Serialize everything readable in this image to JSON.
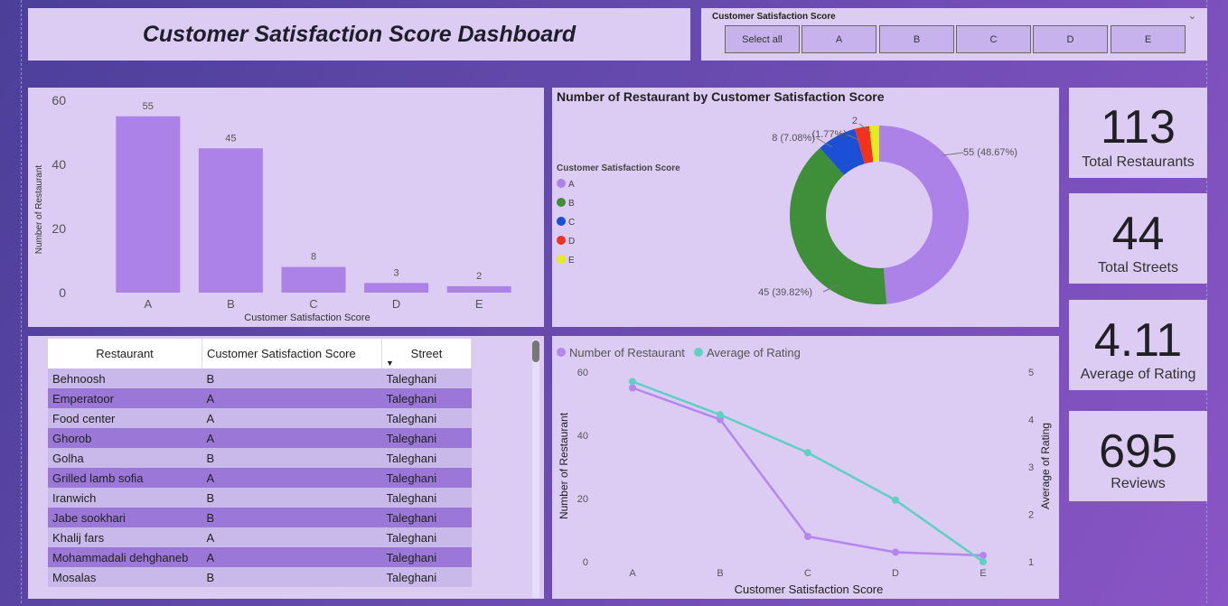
{
  "title": "Customer Satisfaction Score Dashboard",
  "slicer": {
    "title": "Customer Satisfaction Score",
    "options": [
      "Select all",
      "A",
      "B",
      "C",
      "D",
      "E"
    ]
  },
  "kpis": [
    {
      "value": "113",
      "label": "Total Restaurants"
    },
    {
      "value": "44",
      "label": "Total Streets"
    },
    {
      "value": "4.11",
      "label": "Average of Rating"
    },
    {
      "value": "695",
      "label": "Reviews"
    }
  ],
  "table": {
    "headers": [
      "Restaurant",
      "Customer Satisfaction Score",
      "Street"
    ],
    "rows": [
      [
        "Behnoosh",
        "B",
        "Taleghani"
      ],
      [
        "Emperatoor",
        "A",
        "Taleghani"
      ],
      [
        "Food center",
        "A",
        "Taleghani"
      ],
      [
        "Ghorob",
        "A",
        "Taleghani"
      ],
      [
        "Golha",
        "B",
        "Taleghani"
      ],
      [
        "Grilled lamb sofia",
        "A",
        "Taleghani"
      ],
      [
        "Iranwich",
        "B",
        "Taleghani"
      ],
      [
        "Jabe sookhari",
        "B",
        "Taleghani"
      ],
      [
        "Khalij fars",
        "A",
        "Taleghani"
      ],
      [
        "Mohammadali dehghaneb",
        "A",
        "Taleghani"
      ],
      [
        "Mosalas",
        "B",
        "Taleghani"
      ]
    ]
  },
  "colors": {
    "bar": "#ad82e8",
    "line_count": "#b487ef",
    "line_rating": "#5fd0c4",
    "A": "#ad82e8",
    "B": "#3f8f3a",
    "C": "#1a4fd6",
    "D": "#f2321e",
    "E": "#e3ec1c"
  },
  "chart_data": [
    {
      "type": "bar",
      "categories": [
        "A",
        "B",
        "C",
        "D",
        "E"
      ],
      "values": [
        55,
        45,
        8,
        3,
        2
      ],
      "data_labels": [
        "55",
        "45",
        "8",
        "3",
        "2"
      ],
      "title": "",
      "xlabel": "Customer Satisfaction Score",
      "ylabel": "Number of Restaurant",
      "ylim": [
        0,
        60
      ],
      "yticks": [
        "0",
        "20",
        "40",
        "60"
      ]
    },
    {
      "type": "pie",
      "title": "Number of Restaurant by Customer Satisfaction Score",
      "legend_title": "Customer Satisfaction Score",
      "categories": [
        "A",
        "B",
        "C",
        "D",
        "E"
      ],
      "values": [
        55,
        45,
        8,
        3,
        2
      ],
      "data_labels": [
        "55 (48.67%)",
        "45 (39.82%)",
        "8 (7.08%)",
        "(1.77%)",
        "2"
      ],
      "legend_position": "left"
    },
    {
      "type": "line",
      "categories": [
        "A",
        "B",
        "C",
        "D",
        "E"
      ],
      "series": [
        {
          "name": "Number of Restaurant",
          "values": [
            55,
            45,
            8,
            3,
            2
          ],
          "axis": "left"
        },
        {
          "name": "Average of Rating",
          "values": [
            4.8,
            4.1,
            3.3,
            2.3,
            1.0
          ],
          "axis": "right"
        }
      ],
      "xlabel": "Customer Satisfaction Score",
      "ylabel": "Number of Restaurant",
      "y2label": "Average of Rating",
      "ylim": [
        0,
        60
      ],
      "y2lim": [
        1,
        5
      ],
      "yticks": [
        "0",
        "20",
        "40",
        "60"
      ],
      "y2ticks": [
        "1",
        "2",
        "3",
        "4",
        "5"
      ],
      "legend_position": "top-left"
    }
  ]
}
